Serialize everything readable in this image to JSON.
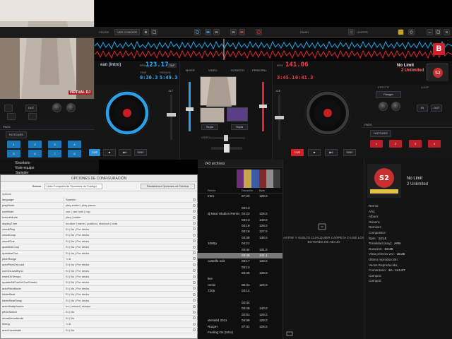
{
  "webcam": {
    "watermark": "VIRTUAL DJ"
  },
  "topbar": {
    "label_left": "CROSS",
    "btn_left": "VER CONCIER",
    "label_right": "PANEL",
    "label_limiter": "LIMITER"
  },
  "left_deck": {
    "title_fragment": "ean (Intro)",
    "bpm_label": "BPM",
    "bpm": "123.17",
    "tap": "TAP",
    "time_label": "TIME",
    "elapsed": "0:30.3",
    "remain_label": "REMAIN",
    "remain": "5:49.3",
    "gain_label": "-0.7",
    "knob_labels": [
      "GAIN",
      "FILTER",
      "LOW",
      "MID",
      "HIGH",
      "LIM"
    ],
    "loop_label": "LOOP",
    "pads_label": "PADS",
    "hotcues_label": "HOTCUES",
    "pads": [
      "1",
      "2",
      "3",
      "4",
      "5",
      "6",
      "7",
      "8"
    ],
    "controls": {
      "cue": "CUE",
      "stop": "■",
      "play": "▶II",
      "sync": "SINC"
    }
  },
  "right_deck": {
    "bpm": "141.06",
    "bpm_label": "BPM",
    "elapsed": "3:45.1",
    "remain": "0:41.3",
    "track_title": "No Limit",
    "track_artist": "2 Unlimited",
    "effect_label": "EFECTO",
    "effect_value": "Flanger",
    "loop_label": "LOOP",
    "pitch_value": "-0.5",
    "pads_label": "PADS",
    "hotcues_label": "HOTCUES",
    "pads": [
      "1",
      "2",
      "3",
      "4",
      "5",
      "6",
      "7",
      "8"
    ],
    "controls": {
      "cue": "CUE",
      "stop": "■",
      "play": "▶II",
      "sync": "SINC"
    }
  },
  "mixer": {
    "tabs": [
      "MIXER",
      "VIDEO",
      "SCRATCH",
      "PRINCIPAL"
    ],
    "video_transitions": [
      "Sepia",
      "Sepia"
    ],
    "crossfader_label": "VIDEO",
    "master_label": "MASTER"
  },
  "folders": {
    "items": [
      "Escritorio",
      "Este equipo",
      "Sampler"
    ]
  },
  "config": {
    "title": "OPCIONES DE CONFIGURACIÓN",
    "search_label": "Buscar",
    "search_value": "Lista Completa de Opciones de Configu",
    "reset_button": "Restablecer Opciones de Fábrica",
    "column_header": "options",
    "rows": [
      {
        "k": "language",
        "v": "Spanish"
      },
      {
        "k": "playMode",
        "v": "play-stutter | play-pause"
      },
      {
        "k": "cueMode",
        "v": "cue | cue-hold | cup"
      },
      {
        "k": "hotcueMode",
        "v": "play | stutter"
      },
      {
        "k": "displayTime",
        "v": "number | name | position | distance | beat"
      },
      {
        "k": "circuitPlay",
        "v": "Sí | No | Por decks"
      },
      {
        "k": "circuitLoop",
        "v": "Sí | No | Por decks"
      },
      {
        "k": "circuitCue",
        "v": "Sí | No | Por decks"
      },
      {
        "k": "quantizeLoop",
        "v": "Sí | No | Por decks"
      },
      {
        "k": "quantizeCue",
        "v": "Sí | No | Por decks"
      },
      {
        "k": "pitchRange",
        "v": "+/-8"
      },
      {
        "k": "autoPitchOnLoad",
        "v": "Sí | No | Por decks"
      },
      {
        "k": "cueOnLoadSync",
        "v": "Sí | No | Por decks"
      },
      {
        "k": "resetOnTempo",
        "v": "Sí | No | Por decks"
      },
      {
        "k": "updateAllCueOnCueCombo",
        "v": "Sí | No | Por decks"
      },
      {
        "k": "autoPitchMode",
        "v": "Sí | No | Por decks"
      },
      {
        "k": "folderBeat",
        "v": "Sí | No | Por decks"
      },
      {
        "k": "folderBeatSwap",
        "v": "Sí | No | Por decks"
      },
      {
        "k": "autoHeadphones",
        "v": "no | onload | always"
      },
      {
        "k": "pflOnSelect",
        "v": "Sí | No"
      },
      {
        "k": "showDemoMode",
        "v": "Sí | No"
      },
      {
        "k": "timing",
        "v": "+/-8"
      },
      {
        "k": "autoCrossfader",
        "v": "Sí | No"
      }
    ]
  },
  "filelist": {
    "count": "243 archivos",
    "headers": {
      "remix": "Remix",
      "duration": "Duración",
      "bpm": "Bpm"
    },
    "rows": [
      {
        "remix": "Intro",
        "dur": "07:20",
        "bpm": "128.0",
        "hl": false
      },
      {
        "remix": "",
        "dur": "",
        "bpm": "",
        "hl": false
      },
      {
        "remix": "",
        "dur": "03:13",
        "bpm": "",
        "hl": false
      },
      {
        "remix": "dj Maxi Studios Remix",
        "dur": "04:22",
        "bpm": "128.0",
        "hl": false
      },
      {
        "remix": "",
        "dur": "03:13",
        "bpm": "140.0",
        "hl": false
      },
      {
        "remix": "",
        "dur": "03:19",
        "bpm": "128.0",
        "hl": false
      },
      {
        "remix": "",
        "dur": "03:18",
        "bpm": "127.0",
        "hl": false
      },
      {
        "remix": "",
        "dur": "03:38",
        "bpm": "135.0",
        "hl": false
      },
      {
        "remix": "1080p",
        "dur": "04:21",
        "bpm": "",
        "hl": false
      },
      {
        "remix": "",
        "dur": "03:44",
        "bpm": "131.0",
        "hl": false
      },
      {
        "remix": "",
        "dur": "03:45",
        "bpm": "141.1",
        "hl": true
      },
      {
        "remix": "castells edit",
        "dur": "03:17",
        "bpm": "133.0",
        "hl": false
      },
      {
        "remix": "",
        "dur": "03:12",
        "bpm": "",
        "hl": false
      },
      {
        "remix": "",
        "dur": "03:45",
        "bpm": "128.0",
        "hl": false
      },
      {
        "remix": "live",
        "dur": "",
        "bpm": "",
        "hl": false
      },
      {
        "remix": "remix",
        "dur": "06:31",
        "bpm": "128.0",
        "hl": false
      },
      {
        "remix": "720p",
        "dur": "03:14",
        "bpm": "",
        "hl": false
      },
      {
        "remix": "",
        "dur": "",
        "bpm": "",
        "hl": false
      },
      {
        "remix": "",
        "dur": "03:34",
        "bpm": "",
        "hl": false
      },
      {
        "remix": "",
        "dur": "03:48",
        "bpm": "140.0",
        "hl": false
      },
      {
        "remix": "",
        "dur": "02:51",
        "bpm": "128.0",
        "hl": false
      },
      {
        "remix": "xtended 2011",
        "dur": "04:08",
        "bpm": "128.0",
        "hl": false
      },
      {
        "remix": "RaLpH",
        "dur": "07:31",
        "bpm": "128.0",
        "hl": false
      },
      {
        "remix": "Feeling On (Intro)",
        "dur": "",
        "bpm": "",
        "hl": false
      }
    ]
  },
  "sidelist": {
    "drop_message": "ASTRE Y SUELTE CUALQUIER CARPETA O USE LOS BOTONES DE ABAJO"
  },
  "info": {
    "title": "No Limit",
    "artist": "2 Unlimited",
    "fields": [
      {
        "k": "Remix:",
        "v": ""
      },
      {
        "k": "Año:",
        "v": ""
      },
      {
        "k": "Album:",
        "v": ""
      },
      {
        "k": "Género:",
        "v": ""
      },
      {
        "k": "Remixer:",
        "v": ""
      },
      {
        "k": "Compositor:",
        "v": ""
      },
      {
        "k": "Bpm:",
        "v": "141.0"
      },
      {
        "k": "Tonalidad (Key):",
        "v": "A#m"
      },
      {
        "k": "Duración:",
        "v": "03:45"
      },
      {
        "k": "Vista primera vez:",
        "v": "15:25"
      },
      {
        "k": "Último reproducción:",
        "v": ""
      },
      {
        "k": "Veces Reproducida:",
        "v": ""
      },
      {
        "k": "Comentario:",
        "v": "3A - 141.07"
      },
      {
        "k": "Campo1:",
        "v": ""
      },
      {
        "k": "Campo2:",
        "v": ""
      }
    ]
  },
  "colors": {
    "left_accent": "#2aa1e6",
    "right_accent": "#e0252f",
    "config_bg": "#f2f2f2"
  }
}
